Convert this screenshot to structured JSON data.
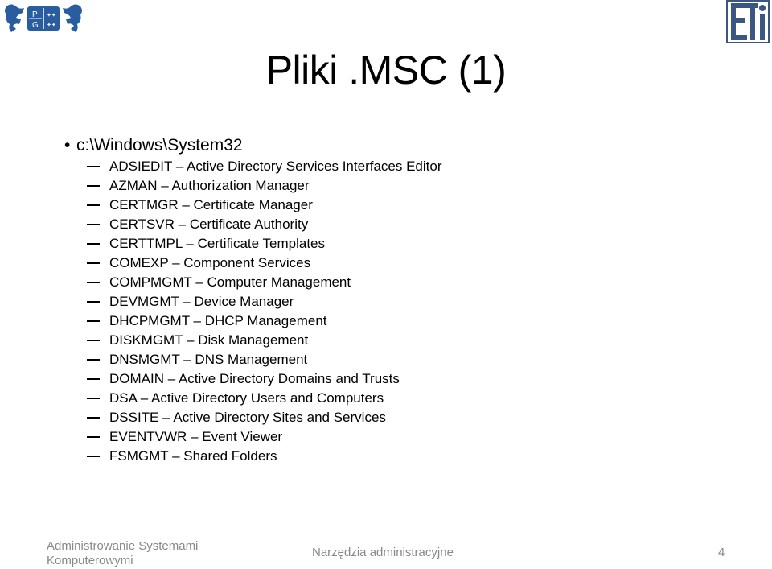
{
  "slide": {
    "title": "Pliki .MSC (1)",
    "bullet": {
      "symbol": "•",
      "text": "c:\\Windows\\System32"
    },
    "items": [
      {
        "code": "ADSIEDIT",
        "description": "Active Directory Services Interfaces Editor",
        "text": "ADSIEDIT – Active Directory Services Interfaces Editor"
      },
      {
        "code": "AZMAN",
        "description": "Authorization Manager",
        "text": "AZMAN – Authorization Manager"
      },
      {
        "code": "CERTMGR",
        "description": "Certificate Manager",
        "text": "CERTMGR – Certificate Manager"
      },
      {
        "code": "CERTSVR",
        "description": "Certificate Authority",
        "text": "CERTSVR – Certificate Authority"
      },
      {
        "code": "CERTTMPL",
        "description": "Certificate Templates",
        "text": "CERTTMPL – Certificate Templates"
      },
      {
        "code": "COMEXP",
        "description": "Component Services",
        "text": "COMEXP – Component Services"
      },
      {
        "code": "COMPMGMT",
        "description": "Computer Management",
        "text": "COMPMGMT – Computer Management"
      },
      {
        "code": "DEVMGMT",
        "description": "Device Manager",
        "text": "DEVMGMT – Device Manager"
      },
      {
        "code": "DHCPMGMT",
        "description": "DHCP Management",
        "text": "DHCPMGMT – DHCP Management"
      },
      {
        "code": "DISKMGMT",
        "description": "Disk Management",
        "text": "DISKMGMT – Disk Management"
      },
      {
        "code": "DNSMGMT",
        "description": "DNS Management",
        "text": "DNSMGMT – DNS Management"
      },
      {
        "code": "DOMAIN",
        "description": "Active Directory Domains and Trusts",
        "text": "DOMAIN – Active Directory Domains and Trusts"
      },
      {
        "code": "DSA",
        "description": "Active Directory Users and Computers",
        "text": "DSA – Active Directory Users and Computers"
      },
      {
        "code": "DSSITE",
        "description": "Active Directory Sites and Services",
        "text": "DSSITE – Active Directory Sites and Services"
      },
      {
        "code": "EVENTVWR",
        "description": "Event Viewer",
        "text": "EVENTVWR – Event Viewer"
      },
      {
        "code": "FSMGMT",
        "description": "Shared Folders",
        "text": "FSMGMT – Shared Folders"
      }
    ]
  },
  "logos": {
    "left": {
      "name": "pg-logo",
      "letters": [
        "P",
        "G"
      ],
      "color": "#1f4e8c"
    },
    "right": {
      "name": "eti-logo",
      "text": "ETI",
      "color": "#3b5683"
    }
  },
  "footer": {
    "left_line1": "Administrowanie Systemami",
    "left_line2": "Komputerowymi",
    "center": "Narzędzia administracyjne",
    "page_number": "4"
  }
}
